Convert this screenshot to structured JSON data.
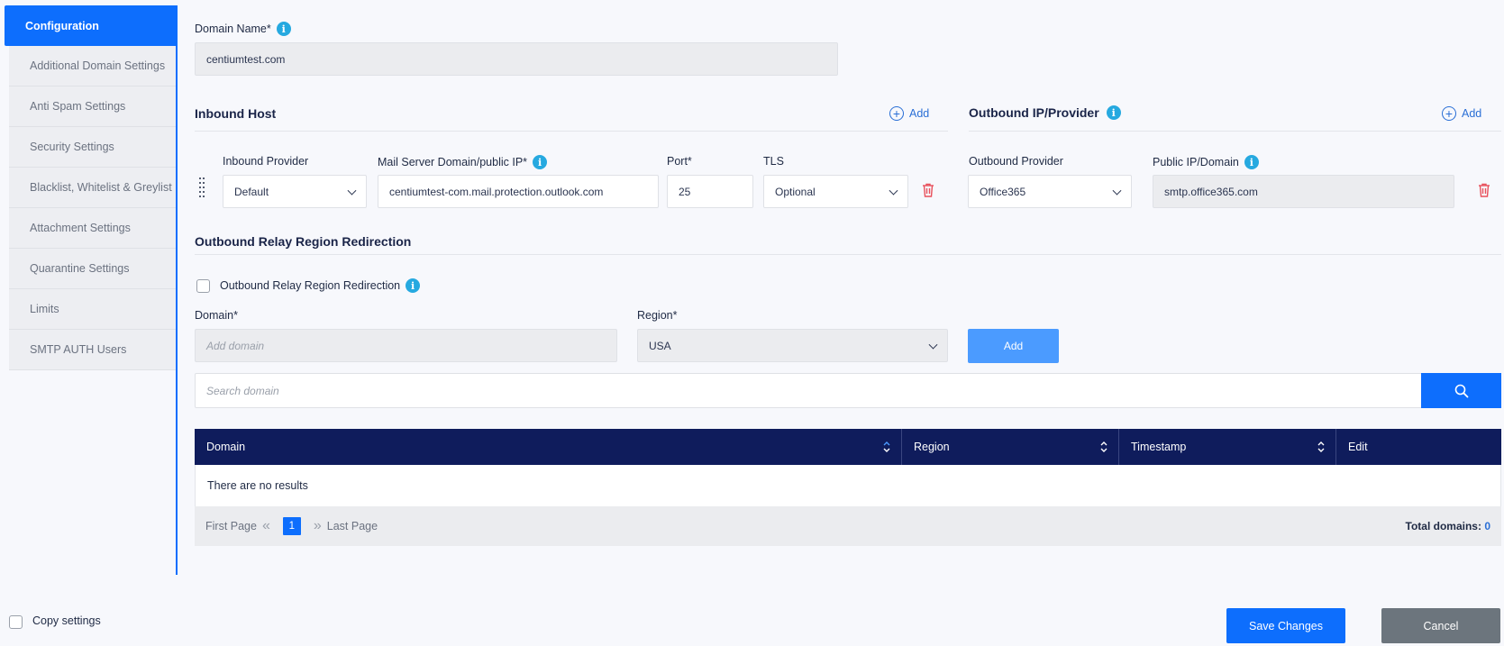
{
  "sidebar": {
    "items": [
      {
        "label": "Configuration",
        "active": true
      },
      {
        "label": "Additional Domain Settings"
      },
      {
        "label": "Anti Spam Settings"
      },
      {
        "label": "Security Settings"
      },
      {
        "label": "Blacklist, Whitelist & Greylist"
      },
      {
        "label": "Attachment Settings"
      },
      {
        "label": "Quarantine Settings"
      },
      {
        "label": "Limits"
      },
      {
        "label": "SMTP AUTH Users"
      }
    ]
  },
  "domain_name": {
    "label": "Domain Name*",
    "value": "centiumtest.com"
  },
  "inbound": {
    "title": "Inbound Host",
    "add_label": "Add",
    "provider_label": "Inbound Provider",
    "provider_value": "Default",
    "mail_server_label": "Mail Server Domain/public IP*",
    "mail_server_value": "centiumtest-com.mail.protection.outlook.com",
    "port_label": "Port*",
    "port_value": "25",
    "tls_label": "TLS",
    "tls_value": "Optional"
  },
  "outbound": {
    "title": "Outbound IP/Provider",
    "add_label": "Add",
    "provider_label": "Outbound Provider",
    "provider_value": "Office365",
    "public_ip_label": "Public IP/Domain",
    "public_ip_value": "smtp.office365.com"
  },
  "relay": {
    "title": "Outbound Relay Region Redirection",
    "checkbox_label": "Outbound Relay Region Redirection",
    "domain_label": "Domain*",
    "domain_placeholder": "Add domain",
    "region_label": "Region*",
    "region_value": "USA",
    "add_button": "Add",
    "search_placeholder": "Search domain"
  },
  "table": {
    "columns": [
      "Domain",
      "Region",
      "Timestamp",
      "Edit"
    ],
    "empty_text": "There are no results",
    "first_page": "First Page",
    "last_page": "Last Page",
    "current_page": "1",
    "total_label": "Total domains:",
    "total_value": "0"
  },
  "footer": {
    "copy_settings": "Copy settings",
    "save": "Save Changes",
    "cancel": "Cancel"
  },
  "colors": {
    "accent": "#0d6efd",
    "table_header": "#0f1c5c",
    "danger": "#e8505b",
    "cancel": "#6c757d"
  }
}
